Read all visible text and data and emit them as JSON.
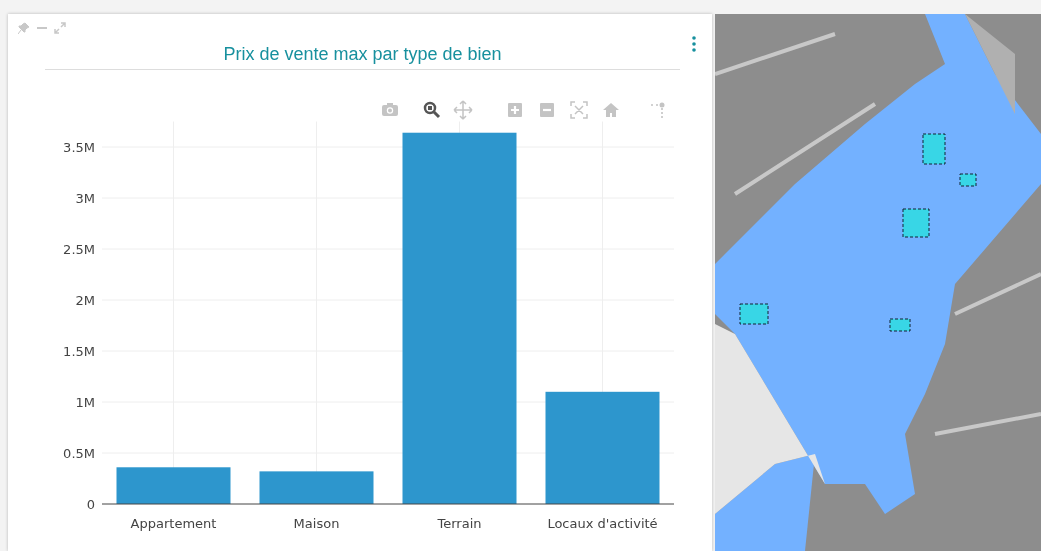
{
  "panel": {
    "title": "Prix de vente max par type de bien",
    "chart_data": {
      "type": "bar",
      "categories": [
        "Appartement",
        "Maison",
        "Terrain",
        "Locaux d'activité"
      ],
      "values": [
        360000,
        320000,
        3640000,
        1100000
      ],
      "ylim": [
        0,
        3750000
      ],
      "grid": true,
      "yticks": [
        {
          "value": 0,
          "label": "0"
        },
        {
          "value": 500000,
          "label": "0.5M"
        },
        {
          "value": 1000000,
          "label": "1M"
        },
        {
          "value": 1500000,
          "label": "1.5M"
        },
        {
          "value": 2000000,
          "label": "2M"
        },
        {
          "value": 2500000,
          "label": "2.5M"
        },
        {
          "value": 3000000,
          "label": "3M"
        },
        {
          "value": 3500000,
          "label": "3.5M"
        }
      ]
    }
  }
}
